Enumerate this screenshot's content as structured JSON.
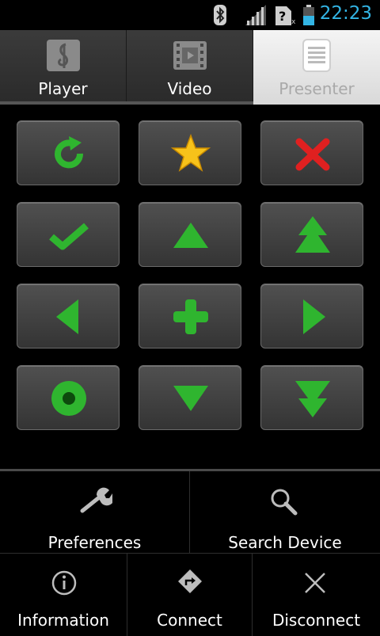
{
  "status": {
    "time": "22:23"
  },
  "tabs": [
    {
      "label": "Player",
      "icon": "music-note-icon",
      "active": false
    },
    {
      "label": "Video",
      "icon": "film-icon",
      "active": false
    },
    {
      "label": "Presenter",
      "icon": "document-icon",
      "active": true
    }
  ],
  "remote_buttons": [
    {
      "icon": "refresh-icon"
    },
    {
      "icon": "star-icon"
    },
    {
      "icon": "close-x-icon"
    },
    {
      "icon": "checkmark-icon"
    },
    {
      "icon": "arrow-up-icon"
    },
    {
      "icon": "double-arrow-up-icon"
    },
    {
      "icon": "arrow-left-icon"
    },
    {
      "icon": "plus-icon"
    },
    {
      "icon": "arrow-right-icon"
    },
    {
      "icon": "record-dot-icon"
    },
    {
      "icon": "arrow-down-icon"
    },
    {
      "icon": "double-arrow-down-icon"
    }
  ],
  "menu": {
    "preferences": "Preferences",
    "search_device": "Search Device",
    "information": "Information",
    "connect": "Connect",
    "disconnect": "Disconnect"
  },
  "colors": {
    "accent_blue": "#33b5e5",
    "icon_green": "#2fb52f",
    "icon_red": "#e02020",
    "star_yellow": "#f7c21a"
  }
}
